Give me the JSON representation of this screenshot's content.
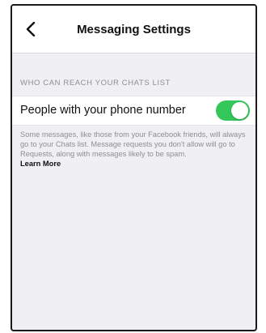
{
  "nav": {
    "title": "Messaging Settings",
    "back_icon": "chevron-left-icon"
  },
  "section": {
    "header": "WHO CAN REACH YOUR CHATS LIST"
  },
  "setting": {
    "label": "People with your phone number",
    "toggle_on": true,
    "toggle_color": "#34c759"
  },
  "footer": {
    "description": "Some messages, like those from your Facebook friends, will always go to your Chats list. Message requests you don't allow will go to Requests, along with messages likely to be spam.",
    "learn_more": "Learn More"
  }
}
